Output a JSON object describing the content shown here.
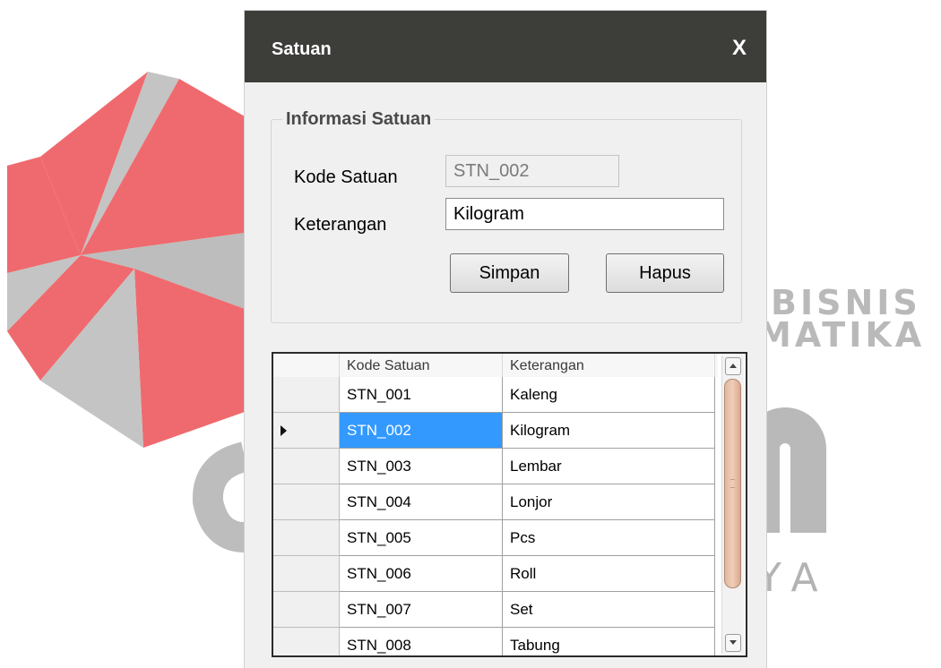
{
  "window": {
    "title": "Satuan",
    "close_label": "X"
  },
  "form": {
    "group_title": "Informasi Satuan",
    "kode_label": "Kode Satuan",
    "kode_value": "STN_002",
    "keterangan_label": "Keterangan",
    "keterangan_value": "Kilogram",
    "simpan_label": "Simpan",
    "hapus_label": "Hapus"
  },
  "grid": {
    "columns": [
      "Kode Satuan",
      "Keterangan"
    ],
    "rows": [
      {
        "kode": "STN_001",
        "keterangan": "Kaleng"
      },
      {
        "kode": "STN_002",
        "keterangan": "Kilogram",
        "selected": true
      },
      {
        "kode": "STN_003",
        "keterangan": "Lembar"
      },
      {
        "kode": "STN_004",
        "keterangan": "Lonjor"
      },
      {
        "kode": "STN_005",
        "keterangan": "Pcs"
      },
      {
        "kode": "STN_006",
        "keterangan": "Roll"
      },
      {
        "kode": "STN_007",
        "keterangan": "Set"
      },
      {
        "kode": "STN_008",
        "keterangan": "Tabung"
      }
    ]
  },
  "watermark": {
    "text_line1": "BISNIS",
    "text_line2": "MATIKA",
    "text_line3": "YA",
    "logo_color": "#ef6a6e",
    "gray_color": "#bdbdbd"
  }
}
